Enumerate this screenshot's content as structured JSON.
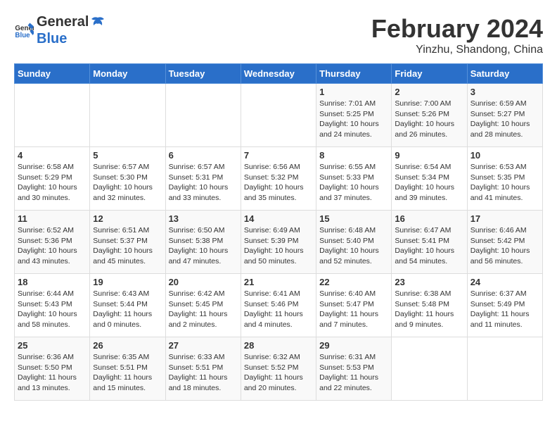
{
  "header": {
    "logo_general": "General",
    "logo_blue": "Blue",
    "title": "February 2024",
    "subtitle": "Yinzhu, Shandong, China"
  },
  "columns": [
    "Sunday",
    "Monday",
    "Tuesday",
    "Wednesday",
    "Thursday",
    "Friday",
    "Saturday"
  ],
  "weeks": [
    [
      {
        "day": "",
        "info": ""
      },
      {
        "day": "",
        "info": ""
      },
      {
        "day": "",
        "info": ""
      },
      {
        "day": "",
        "info": ""
      },
      {
        "day": "1",
        "info": "Sunrise: 7:01 AM\nSunset: 5:25 PM\nDaylight: 10 hours\nand 24 minutes."
      },
      {
        "day": "2",
        "info": "Sunrise: 7:00 AM\nSunset: 5:26 PM\nDaylight: 10 hours\nand 26 minutes."
      },
      {
        "day": "3",
        "info": "Sunrise: 6:59 AM\nSunset: 5:27 PM\nDaylight: 10 hours\nand 28 minutes."
      }
    ],
    [
      {
        "day": "4",
        "info": "Sunrise: 6:58 AM\nSunset: 5:29 PM\nDaylight: 10 hours\nand 30 minutes."
      },
      {
        "day": "5",
        "info": "Sunrise: 6:57 AM\nSunset: 5:30 PM\nDaylight: 10 hours\nand 32 minutes."
      },
      {
        "day": "6",
        "info": "Sunrise: 6:57 AM\nSunset: 5:31 PM\nDaylight: 10 hours\nand 33 minutes."
      },
      {
        "day": "7",
        "info": "Sunrise: 6:56 AM\nSunset: 5:32 PM\nDaylight: 10 hours\nand 35 minutes."
      },
      {
        "day": "8",
        "info": "Sunrise: 6:55 AM\nSunset: 5:33 PM\nDaylight: 10 hours\nand 37 minutes."
      },
      {
        "day": "9",
        "info": "Sunrise: 6:54 AM\nSunset: 5:34 PM\nDaylight: 10 hours\nand 39 minutes."
      },
      {
        "day": "10",
        "info": "Sunrise: 6:53 AM\nSunset: 5:35 PM\nDaylight: 10 hours\nand 41 minutes."
      }
    ],
    [
      {
        "day": "11",
        "info": "Sunrise: 6:52 AM\nSunset: 5:36 PM\nDaylight: 10 hours\nand 43 minutes."
      },
      {
        "day": "12",
        "info": "Sunrise: 6:51 AM\nSunset: 5:37 PM\nDaylight: 10 hours\nand 45 minutes."
      },
      {
        "day": "13",
        "info": "Sunrise: 6:50 AM\nSunset: 5:38 PM\nDaylight: 10 hours\nand 47 minutes."
      },
      {
        "day": "14",
        "info": "Sunrise: 6:49 AM\nSunset: 5:39 PM\nDaylight: 10 hours\nand 50 minutes."
      },
      {
        "day": "15",
        "info": "Sunrise: 6:48 AM\nSunset: 5:40 PM\nDaylight: 10 hours\nand 52 minutes."
      },
      {
        "day": "16",
        "info": "Sunrise: 6:47 AM\nSunset: 5:41 PM\nDaylight: 10 hours\nand 54 minutes."
      },
      {
        "day": "17",
        "info": "Sunrise: 6:46 AM\nSunset: 5:42 PM\nDaylight: 10 hours\nand 56 minutes."
      }
    ],
    [
      {
        "day": "18",
        "info": "Sunrise: 6:44 AM\nSunset: 5:43 PM\nDaylight: 10 hours\nand 58 minutes."
      },
      {
        "day": "19",
        "info": "Sunrise: 6:43 AM\nSunset: 5:44 PM\nDaylight: 11 hours\nand 0 minutes."
      },
      {
        "day": "20",
        "info": "Sunrise: 6:42 AM\nSunset: 5:45 PM\nDaylight: 11 hours\nand 2 minutes."
      },
      {
        "day": "21",
        "info": "Sunrise: 6:41 AM\nSunset: 5:46 PM\nDaylight: 11 hours\nand 4 minutes."
      },
      {
        "day": "22",
        "info": "Sunrise: 6:40 AM\nSunset: 5:47 PM\nDaylight: 11 hours\nand 7 minutes."
      },
      {
        "day": "23",
        "info": "Sunrise: 6:38 AM\nSunset: 5:48 PM\nDaylight: 11 hours\nand 9 minutes."
      },
      {
        "day": "24",
        "info": "Sunrise: 6:37 AM\nSunset: 5:49 PM\nDaylight: 11 hours\nand 11 minutes."
      }
    ],
    [
      {
        "day": "25",
        "info": "Sunrise: 6:36 AM\nSunset: 5:50 PM\nDaylight: 11 hours\nand 13 minutes."
      },
      {
        "day": "26",
        "info": "Sunrise: 6:35 AM\nSunset: 5:51 PM\nDaylight: 11 hours\nand 15 minutes."
      },
      {
        "day": "27",
        "info": "Sunrise: 6:33 AM\nSunset: 5:51 PM\nDaylight: 11 hours\nand 18 minutes."
      },
      {
        "day": "28",
        "info": "Sunrise: 6:32 AM\nSunset: 5:52 PM\nDaylight: 11 hours\nand 20 minutes."
      },
      {
        "day": "29",
        "info": "Sunrise: 6:31 AM\nSunset: 5:53 PM\nDaylight: 11 hours\nand 22 minutes."
      },
      {
        "day": "",
        "info": ""
      },
      {
        "day": "",
        "info": ""
      }
    ]
  ]
}
